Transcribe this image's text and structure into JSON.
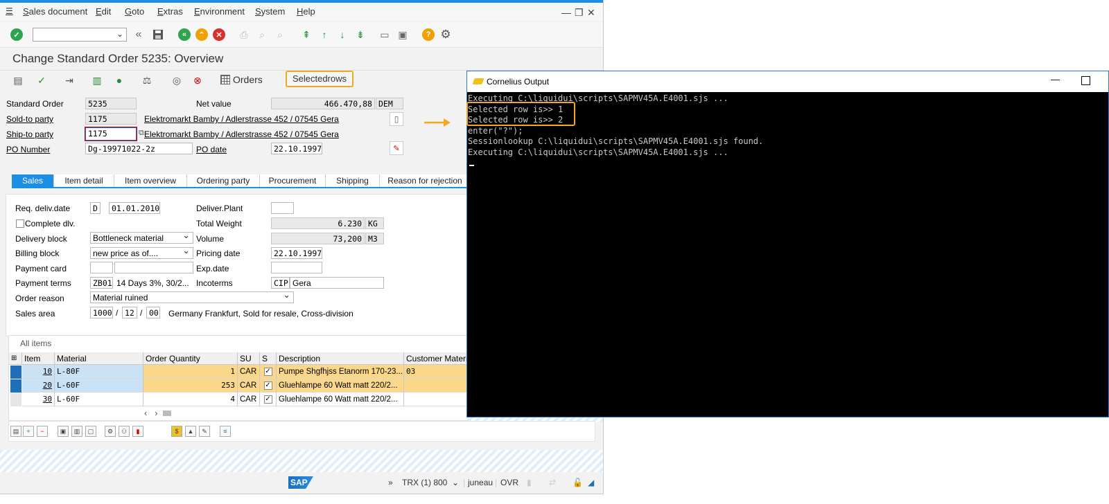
{
  "menu": {
    "items": [
      "Sales document",
      "Edit",
      "Goto",
      "Extras",
      "Environment",
      "System",
      "Help"
    ]
  },
  "window_controls": {
    "minimize": "—",
    "restore": "❐",
    "close": "✕"
  },
  "title": "Change Standard Order 5235: Overview",
  "app_toolbar": {
    "orders_label": "Orders",
    "selectedrows_label": "Selectedrows"
  },
  "header": {
    "standard_order_label": "Standard Order",
    "standard_order_value": "5235",
    "net_value_label": "Net value",
    "net_value": "466.470,88",
    "currency": "DEM",
    "sold_to_label": "Sold-to party",
    "sold_to_value": "1175",
    "sold_to_name": "Elektromarkt Bamby / Adlerstrasse 452 / 07545 Gera",
    "ship_to_label": "Ship-to party",
    "ship_to_value": "1175",
    "ship_to_name": "Elektromarkt Bamby / Adlerstrasse 452 / 07545 Gera",
    "po_number_label": "PO Number",
    "po_number_value": "Dg-19971022-2z",
    "po_date_label": "PO date",
    "po_date_value": "22.10.1997"
  },
  "tabs": [
    "Sales",
    "Item detail",
    "Item overview",
    "Ordering party",
    "Procurement",
    "Shipping",
    "Reason for rejection"
  ],
  "sales": {
    "req_deliv_label": "Req. deliv.date",
    "req_deliv_type": "D",
    "req_deliv_date": "01.01.2010",
    "deliver_plant_label": "Deliver.Plant",
    "deliver_plant_value": "",
    "complete_dlv_label": "Complete dlv.",
    "total_weight_label": "Total Weight",
    "total_weight_value": "6.230",
    "total_weight_unit": "KG",
    "delivery_block_label": "Delivery block",
    "delivery_block_value": "Bottleneck material",
    "volume_label": "Volume",
    "volume_value": "73,200",
    "volume_unit": "M3",
    "billing_block_label": "Billing block",
    "billing_block_value": "new price as of....",
    "pricing_date_label": "Pricing date",
    "pricing_date_value": "22.10.1997",
    "payment_card_label": "Payment card",
    "exp_date_label": "Exp.date",
    "payment_terms_label": "Payment terms",
    "payment_terms_code": "ZB01",
    "payment_terms_text": "14 Days 3%, 30/2...",
    "incoterms_label": "Incoterms",
    "incoterms_code": "CIP",
    "incoterms_text": "Gera",
    "order_reason_label": "Order reason",
    "order_reason_value": "Material ruined",
    "sales_area_label": "Sales area",
    "sales_area_org": "1000",
    "sales_area_ch": "12",
    "sales_area_div": "00",
    "sep1": "/",
    "sep2": "/",
    "sales_area_text": "Germany Frankfurt, Sold for resale, Cross-division"
  },
  "items": {
    "title": "All items",
    "columns": [
      "Item",
      "Material",
      "Order Quantity",
      "SU",
      "S",
      "Description",
      "Customer Materi"
    ],
    "rows": [
      {
        "item": "10",
        "material": "L-80F",
        "qty": "1",
        "su": "CAR",
        "s": "✓",
        "desc": "Pumpe Shgfhjss Etanorm 170-23...",
        "cust": "03"
      },
      {
        "item": "20",
        "material": "L-60F",
        "qty": "253",
        "su": "CAR",
        "s": "✓",
        "desc": "Gluehlampe 60 Watt matt 220/2...",
        "cust": ""
      },
      {
        "item": "30",
        "material": "L-60F",
        "qty": "4",
        "su": "CAR",
        "s": "✓",
        "desc": "Gluehlampe 60 Watt matt 220/2...",
        "cust": ""
      }
    ]
  },
  "status": {
    "trx": "TRX (1) 800",
    "user": "juneau",
    "mode": "OVR"
  },
  "console": {
    "title": "Cornelius Output",
    "lines": [
      "Executing C:\\liquidui\\scripts\\SAPMV45A.E4001.sjs ...",
      "Selected row is>> 1",
      "Selected row is>> 2",
      "enter(\"?\");",
      "Sessionlookup C:\\liquidui\\scripts\\SAPMV45A.E4001.sjs found.",
      "Executing C:\\liquidui\\scripts\\SAPMV45A.E4001.sjs ..."
    ]
  },
  "colors": {
    "accent": "#1c8ee6",
    "highlight": "#f5a623",
    "console_bg": "#000000"
  }
}
